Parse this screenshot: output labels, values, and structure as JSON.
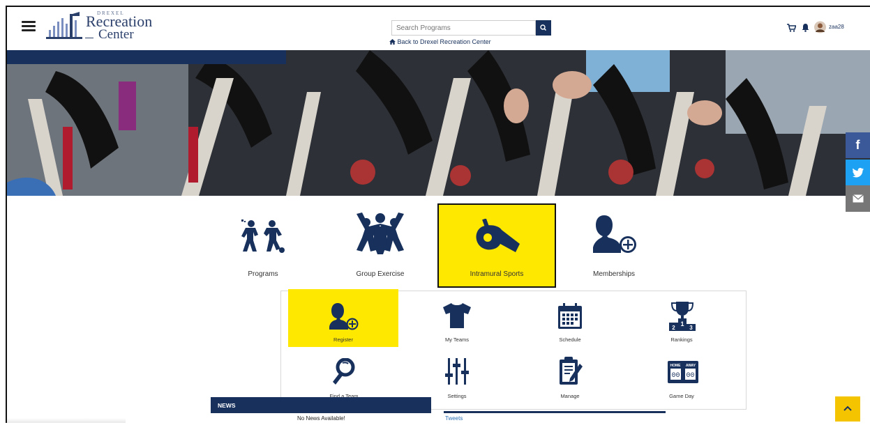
{
  "header": {
    "logo": {
      "small": "DREXEL",
      "main": "Recreation",
      "sub": "Center"
    },
    "search": {
      "placeholder": "Search Programs"
    },
    "back_link": "Back to Drexel Recreation Center",
    "username": "zaa28"
  },
  "social": {
    "facebook": "f",
    "email": "✉"
  },
  "colors": {
    "navy": "#17305c",
    "highlight": "#ffe800",
    "facebook": "#3b5998",
    "twitter": "#1da1f2",
    "email": "#777777",
    "scroll_top": "#f5c400"
  },
  "main_tiles": [
    {
      "label": "Programs",
      "icon": "programs-icon"
    },
    {
      "label": "Group Exercise",
      "icon": "group-exercise-icon"
    },
    {
      "label": "Intramural Sports",
      "icon": "whistle-icon",
      "highlighted": true
    },
    {
      "label": "Memberships",
      "icon": "add-member-icon"
    }
  ],
  "sub_menu": [
    {
      "label": "Register",
      "icon": "register-icon",
      "highlighted": true
    },
    {
      "label": "My Teams",
      "icon": "jersey-icon"
    },
    {
      "label": "Schedule",
      "icon": "calendar-icon"
    },
    {
      "label": "Rankings",
      "icon": "trophy-icon"
    },
    {
      "label": "Find a Team",
      "icon": "magnifier-icon"
    },
    {
      "label": "Settings",
      "icon": "sliders-icon"
    },
    {
      "label": "Manage",
      "icon": "clipboard-icon"
    },
    {
      "label": "Game Day",
      "icon": "scoreboard-icon"
    }
  ],
  "scoreboard": {
    "home": "HOME",
    "away": "AWAY",
    "home_score": "00",
    "away_score": "00"
  },
  "rankings": {
    "second": "2",
    "first": "1",
    "third": "3"
  },
  "news": {
    "title": "NEWS",
    "empty": "No News Available!",
    "tweets_title": "Tweets"
  }
}
